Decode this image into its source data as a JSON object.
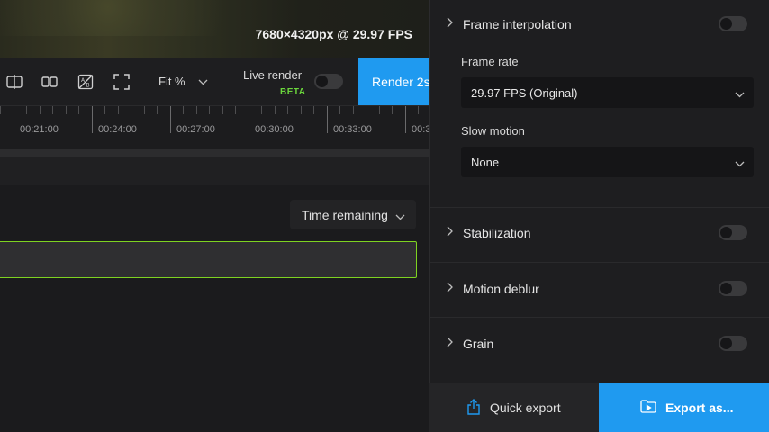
{
  "preview": {
    "resolution": "7680×4320px @ 29.97 FPS"
  },
  "toolbar": {
    "fit_label": "Fit %",
    "live_render_label": "Live render",
    "beta_badge": "BETA",
    "render_button": "Render 2s"
  },
  "timeline": {
    "ticks": [
      "00:21:00",
      "00:24:00",
      "00:27:00",
      "00:30:00",
      "00:33:00",
      "00:3"
    ]
  },
  "time_remaining": {
    "label": "Time remaining"
  },
  "settings": {
    "frame_interpolation": "Frame interpolation",
    "frame_rate_label": "Frame rate",
    "frame_rate_value": "29.97 FPS (Original)",
    "slow_motion_label": "Slow motion",
    "slow_motion_value": "None",
    "stabilization": "Stabilization",
    "motion_deblur": "Motion deblur",
    "grain": "Grain"
  },
  "bottom": {
    "quick_export": "Quick export",
    "export_as": "Export as..."
  },
  "colors": {
    "accent": "#1f9af0",
    "beta": "#6bd63c",
    "progress_border": "#7ed321"
  }
}
